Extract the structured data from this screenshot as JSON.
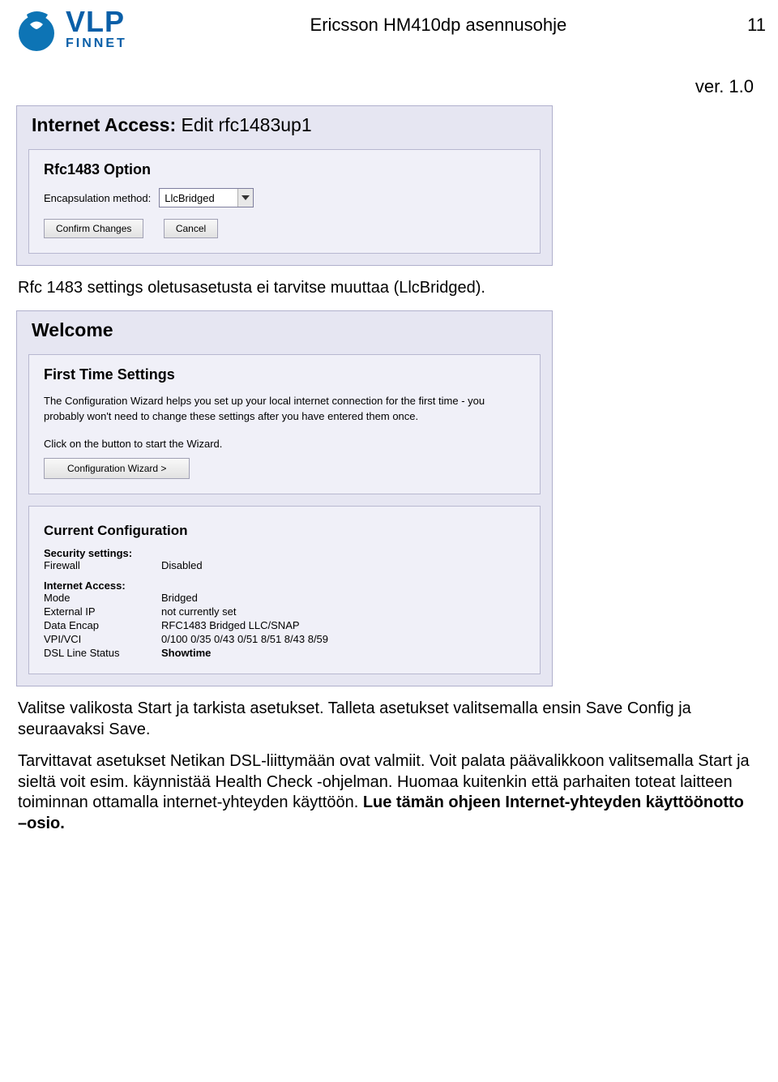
{
  "header": {
    "logo_main": "VLP",
    "logo_sub": "FINNET",
    "doc_title": "Ericsson HM410dp asennusohje",
    "page_number": "11",
    "version": "ver. 1.0"
  },
  "panel1": {
    "title_bold": "Internet Access:",
    "title_light": "Edit rfc1483up1",
    "section": "Rfc1483 Option",
    "encap_label": "Encapsulation method:",
    "encap_value": "LlcBridged",
    "btn_confirm": "Confirm Changes",
    "btn_cancel": "Cancel"
  },
  "text1": "Rfc 1483 settings oletusasetusta ei tarvitse muuttaa (LlcBridged).",
  "welcome": {
    "title": "Welcome",
    "section1": "First Time Settings",
    "para1": "The Configuration Wizard helps you set up your local internet connection for the first time - you probably won't need to change these settings after you have entered them once.",
    "para2": "Click on the button to start the Wizard.",
    "btn_wizard": "Configuration Wizard >",
    "section2": "Current Configuration",
    "security_h": "Security settings:",
    "firewall_k": "Firewall",
    "firewall_v": "Disabled",
    "internet_h": "Internet Access:",
    "mode_k": "Mode",
    "mode_v": "Bridged",
    "extip_k": "External IP",
    "extip_v": "not currently set",
    "encap_k": "Data Encap",
    "encap_v": "RFC1483 Bridged  LLC/SNAP",
    "vpi_k": "VPI/VCI",
    "vpi_v": "0/100  0/35  0/43  0/51  8/51  8/43  8/59",
    "dsl_k": "DSL Line Status",
    "dsl_v": "Showtime"
  },
  "text2a": "Valitse valikosta Start ja tarkista asetukset. Talleta asetukset valitsemalla ensin Save Config ja seuraavaksi Save.",
  "text2b": "Tarvittavat asetukset Netikan DSL-liittymään ovat valmiit. Voit palata päävalikkoon valitsemalla Start ja sieltä voit esim. käynnistää Health Check -ohjelman. Huomaa kuitenkin että parhaiten toteat laitteen toiminnan ottamalla internet-yhteyden käyttöön. ",
  "text2c": "Lue tämän ohjeen Internet-yhteyden käyttöönotto –osio."
}
